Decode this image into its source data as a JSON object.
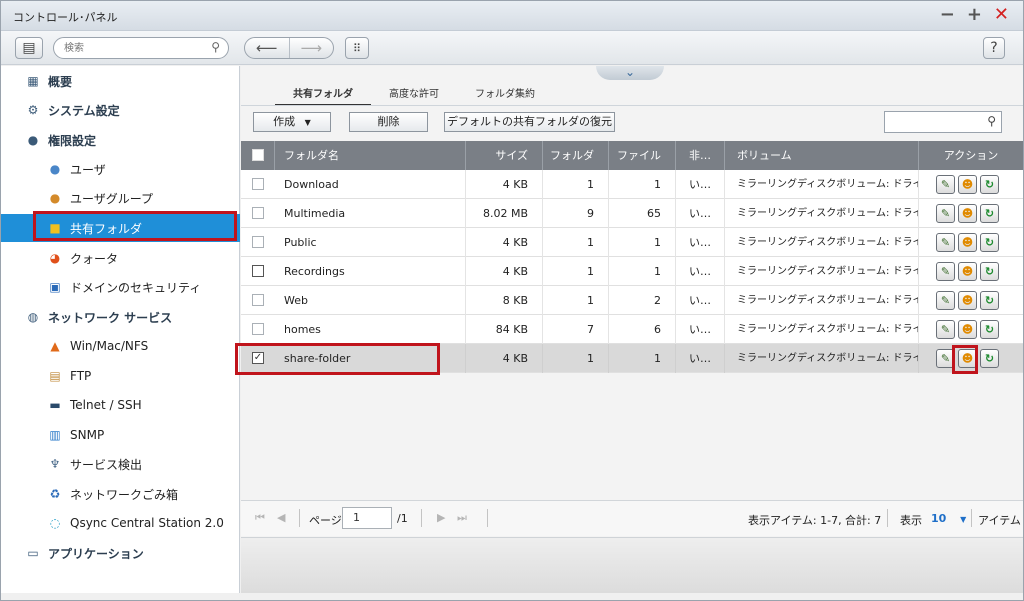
{
  "window": {
    "title": "コントロール･パネル"
  },
  "toolbar": {
    "search_placeholder": "検索",
    "help_label": "?"
  },
  "sidebar": {
    "items": [
      {
        "label": "概要",
        "level": "top",
        "icon": "overview-icon"
      },
      {
        "label": "システム設定",
        "level": "top",
        "icon": "gear-icon"
      },
      {
        "label": "権限設定",
        "level": "top",
        "icon": "user-icon"
      },
      {
        "label": "ユーザ",
        "level": "sub",
        "icon": "user-icon"
      },
      {
        "label": "ユーザグループ",
        "level": "sub",
        "icon": "user-group-icon"
      },
      {
        "label": "共有フォルダ",
        "level": "sub",
        "icon": "shared-folder-icon",
        "active": true
      },
      {
        "label": "クォータ",
        "level": "sub",
        "icon": "quota-icon"
      },
      {
        "label": "ドメインのセキュリティ",
        "level": "sub",
        "icon": "domain-security-icon"
      },
      {
        "label": "ネットワーク サービス",
        "level": "top",
        "icon": "network-icon"
      },
      {
        "label": "Win/Mac/NFS",
        "level": "sub",
        "icon": "win-mac-nfs-icon"
      },
      {
        "label": "FTP",
        "level": "sub",
        "icon": "ftp-icon"
      },
      {
        "label": "Telnet / SSH",
        "level": "sub",
        "icon": "terminal-icon"
      },
      {
        "label": "SNMP",
        "level": "sub",
        "icon": "snmp-icon"
      },
      {
        "label": "サービス検出",
        "level": "sub",
        "icon": "service-discovery-icon"
      },
      {
        "label": "ネットワークごみ箱",
        "level": "sub",
        "icon": "recycle-bin-icon"
      },
      {
        "label": "Qsync Central Station 2.0",
        "level": "sub",
        "icon": "qsync-icon"
      },
      {
        "label": "アプリケーション",
        "level": "top",
        "icon": "applications-icon"
      }
    ]
  },
  "tabs": [
    "共有フォルダ",
    "高度な許可",
    "フォルダ集約"
  ],
  "actions": {
    "create": "作成",
    "delete": "削除",
    "restore": "デフォルトの共有フォルダの復元"
  },
  "table": {
    "headers": [
      "フォルダ名",
      "サイズ",
      "フォルダ",
      "ファイル",
      "非…",
      "ボリューム",
      "アクション"
    ],
    "rows": [
      {
        "name": "Download",
        "size": "4 KB",
        "folders": "1",
        "files": "1",
        "hidden": "い…",
        "volume": "ミラーリングディスクボリューム: ドライブ…",
        "checked": false
      },
      {
        "name": "Multimedia",
        "size": "8.02 MB",
        "folders": "9",
        "files": "65",
        "hidden": "い…",
        "volume": "ミラーリングディスクボリューム: ドライブ…",
        "checked": false
      },
      {
        "name": "Public",
        "size": "4 KB",
        "folders": "1",
        "files": "1",
        "hidden": "い…",
        "volume": "ミラーリングディスクボリューム: ドライブ…",
        "checked": false
      },
      {
        "name": "Recordings",
        "size": "4 KB",
        "folders": "1",
        "files": "1",
        "hidden": "い…",
        "volume": "ミラーリングディスクボリューム: ドライブ…",
        "checked": false
      },
      {
        "name": "Web",
        "size": "8 KB",
        "folders": "1",
        "files": "2",
        "hidden": "い…",
        "volume": "ミラーリングディスクボリューム: ドライブ…",
        "checked": false
      },
      {
        "name": "homes",
        "size": "84 KB",
        "folders": "7",
        "files": "6",
        "hidden": "い…",
        "volume": "ミラーリングディスクボリューム: ドライブ…",
        "checked": false
      },
      {
        "name": "share-folder",
        "size": "4 KB",
        "folders": "1",
        "files": "1",
        "hidden": "い…",
        "volume": "ミラーリングディスクボリューム: ドライブ…",
        "checked": true
      }
    ]
  },
  "pager": {
    "page_label": "ページ",
    "page_value": "1",
    "total_pages": "/1",
    "summary": "表示アイテム: 1-7, 合計: 7",
    "display_label": "表示",
    "per_page": "10",
    "items_label": "アイテム"
  },
  "colors": {
    "highlight": "#c0141c",
    "active": "#1f8fd8"
  }
}
